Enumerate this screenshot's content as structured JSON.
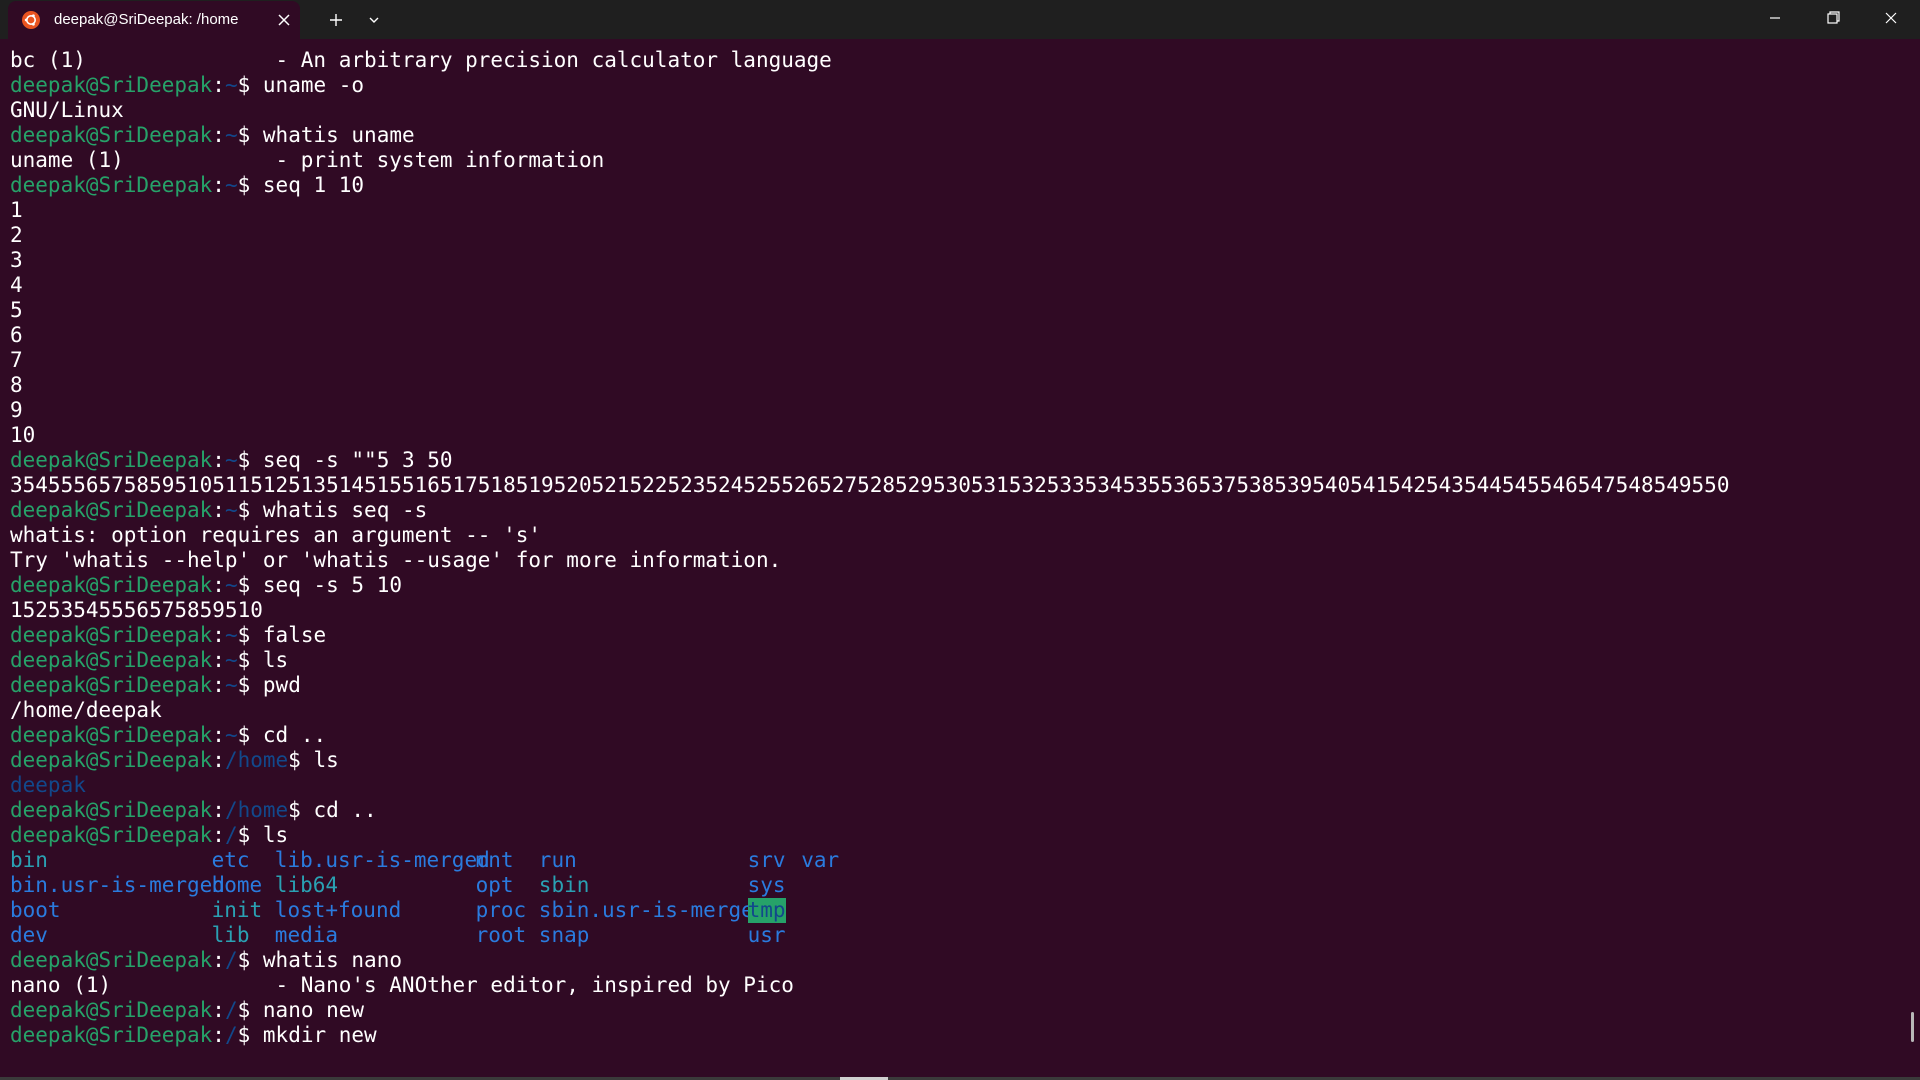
{
  "titlebar": {
    "tab_title": "deepak@SriDeepak: /home",
    "colors": {
      "bar": "#1f1f1f",
      "tab": "#300a24",
      "ubuntu_orange": "#e95420"
    }
  },
  "terminal": {
    "colors": {
      "background": "#300a24",
      "prompt_user": "#26a269",
      "prompt_path": "#12488b",
      "text": "#ffffff",
      "dir": "#2a7bde",
      "link": "#2aa1b3"
    },
    "lines": [
      {
        "type": "out",
        "text": "bc (1)               - An arbitrary precision calculator language"
      },
      {
        "type": "cmd",
        "user": "deepak@SriDeepak",
        "path": "~",
        "cmd": " uname -o"
      },
      {
        "type": "out",
        "text": "GNU/Linux"
      },
      {
        "type": "cmd",
        "user": "deepak@SriDeepak",
        "path": "~",
        "cmd": " whatis uname"
      },
      {
        "type": "out",
        "text": "uname (1)            - print system information"
      },
      {
        "type": "cmd",
        "user": "deepak@SriDeepak",
        "path": "~",
        "cmd": " seq 1 10"
      },
      {
        "type": "out",
        "text": "1"
      },
      {
        "type": "out",
        "text": "2"
      },
      {
        "type": "out",
        "text": "3"
      },
      {
        "type": "out",
        "text": "4"
      },
      {
        "type": "out",
        "text": "5"
      },
      {
        "type": "out",
        "text": "6"
      },
      {
        "type": "out",
        "text": "7"
      },
      {
        "type": "out",
        "text": "8"
      },
      {
        "type": "out",
        "text": "9"
      },
      {
        "type": "out",
        "text": "10"
      },
      {
        "type": "cmd",
        "user": "deepak@SriDeepak",
        "path": "~",
        "cmd": " seq -s \"\"5 3 50"
      },
      {
        "type": "out",
        "text": "3545556575859510511512513514515516517518519520521522523524525526527528529530531532533534535536537538539540541542543544545546547548549550"
      },
      {
        "type": "cmd",
        "user": "deepak@SriDeepak",
        "path": "~",
        "cmd": " whatis seq -s"
      },
      {
        "type": "out",
        "text": "whatis: option requires an argument -- 's'"
      },
      {
        "type": "out",
        "text": "Try 'whatis --help' or 'whatis --usage' for more information."
      },
      {
        "type": "cmd",
        "user": "deepak@SriDeepak",
        "path": "~",
        "cmd": " seq -s 5 10"
      },
      {
        "type": "out",
        "text": "15253545556575859510"
      },
      {
        "type": "cmd",
        "user": "deepak@SriDeepak",
        "path": "~",
        "cmd": " false"
      },
      {
        "type": "cmd",
        "user": "deepak@SriDeepak",
        "path": "~",
        "cmd": " ls"
      },
      {
        "type": "cmd",
        "user": "deepak@SriDeepak",
        "path": "~",
        "cmd": " pwd"
      },
      {
        "type": "out",
        "text": "/home/deepak"
      },
      {
        "type": "cmd",
        "user": "deepak@SriDeepak",
        "path": "~",
        "cmd": " cd .."
      },
      {
        "type": "cmd",
        "user": "deepak@SriDeepak",
        "path": "/home",
        "cmd": " ls"
      },
      {
        "type": "dir",
        "text": "deepak"
      },
      {
        "type": "cmd",
        "user": "deepak@SriDeepak",
        "path": "/home",
        "cmd": " cd .."
      },
      {
        "type": "cmd",
        "user": "deepak@SriDeepak",
        "path": "/",
        "cmd": " ls"
      },
      {
        "type": "ls",
        "row": 0
      },
      {
        "type": "ls",
        "row": 1
      },
      {
        "type": "ls",
        "row": 2
      },
      {
        "type": "ls",
        "row": 3
      },
      {
        "type": "cmd",
        "user": "deepak@SriDeepak",
        "path": "/",
        "cmd": " whatis nano"
      },
      {
        "type": "out",
        "text": "nano (1)             - Nano's ANOther editor, inspired by Pico"
      },
      {
        "type": "cmd",
        "user": "deepak@SriDeepak",
        "path": "/",
        "cmd": " nano new"
      },
      {
        "type": "cmd",
        "user": "deepak@SriDeepak",
        "path": "/",
        "cmd": " mkdir new"
      }
    ],
    "ls_grid": [
      [
        {
          "t": "bin",
          "k": "link"
        },
        {
          "t": "etc",
          "k": "dir"
        },
        {
          "t": "lib.usr-is-merged",
          "k": "dir"
        },
        {
          "t": "mnt",
          "k": "dir"
        },
        {
          "t": "run",
          "k": "dir"
        },
        {
          "t": "srv",
          "k": "dir"
        },
        {
          "t": "var",
          "k": "dir"
        }
      ],
      [
        {
          "t": "bin.usr-is-merged",
          "k": "dir"
        },
        {
          "t": "home",
          "k": "dir"
        },
        {
          "t": "lib64",
          "k": "link"
        },
        {
          "t": "opt",
          "k": "dir"
        },
        {
          "t": "sbin",
          "k": "link"
        },
        {
          "t": "sys",
          "k": "dir"
        }
      ],
      [
        {
          "t": "boot",
          "k": "dir"
        },
        {
          "t": "init",
          "k": "link"
        },
        {
          "t": "lost+found",
          "k": "dir"
        },
        {
          "t": "proc",
          "k": "dir"
        },
        {
          "t": "sbin.usr-is-merged",
          "k": "dir"
        },
        {
          "t": "tmp",
          "k": "tmp"
        }
      ],
      [
        {
          "t": "dev",
          "k": "dir"
        },
        {
          "t": "lib",
          "k": "link"
        },
        {
          "t": "media",
          "k": "dir"
        },
        {
          "t": "root",
          "k": "dir"
        },
        {
          "t": "snap",
          "k": "dir"
        },
        {
          "t": "usr",
          "k": "dir"
        }
      ]
    ]
  }
}
